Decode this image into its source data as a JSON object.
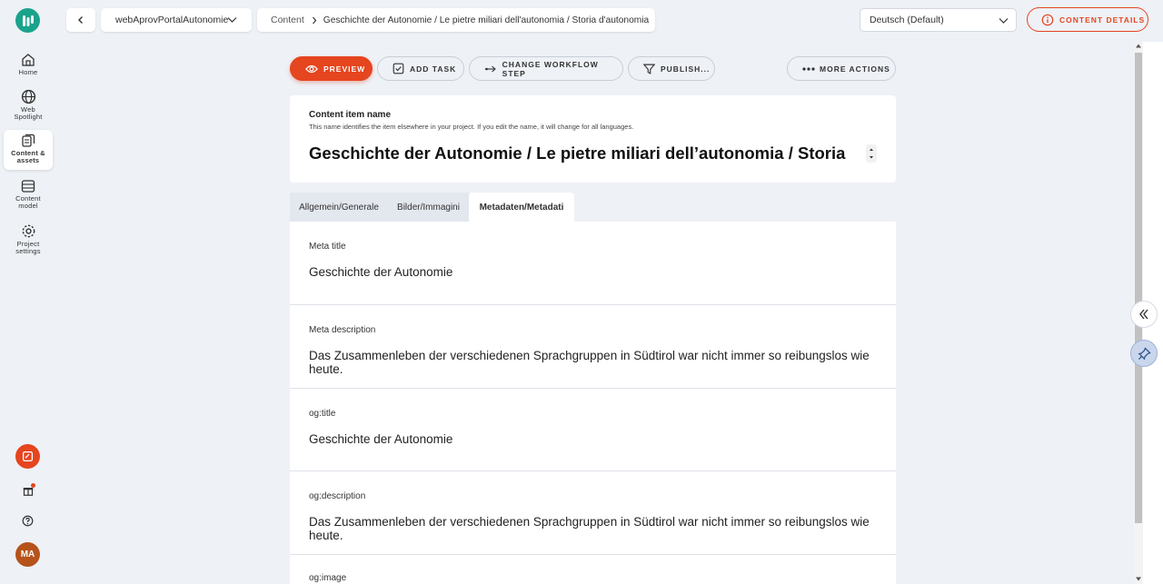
{
  "rail": {
    "items": [
      {
        "label": "Home",
        "icon": "home-icon"
      },
      {
        "label": "Web Spotlight",
        "icon": "globe-icon"
      },
      {
        "label": "Content & assets",
        "icon": "content-icon"
      },
      {
        "label": "Content model",
        "icon": "model-icon"
      },
      {
        "label": "Project settings",
        "icon": "gear-icon"
      }
    ],
    "avatar": "MA"
  },
  "topbar": {
    "project": "webAprovPortalAutonomie",
    "breadcrumb": {
      "root": "Content",
      "item": "Geschichte der Autonomie / Le pietre miliari dell'autonomia / Storia d'autonomia"
    },
    "language": "Deutsch (Default)",
    "details_label": "CONTENT DETAILS"
  },
  "actions": {
    "preview": "PREVIEW",
    "add_task": "ADD TASK",
    "workflow": "CHANGE WORKFLOW STEP",
    "publish": "PUBLISH...",
    "more": "MORE ACTIONS"
  },
  "item_name": {
    "label": "Content item name",
    "hint": "This name identifies the item elsewhere in your project. If you edit the name, it will change for all languages.",
    "value": "Geschichte der Autonomie / Le pietre miliari dell’autonomia / Storia"
  },
  "tabs": [
    "Allgemein/Generale",
    "Bilder/Immagini",
    "Metadaten/Metadati"
  ],
  "fields": [
    {
      "label": "Meta title",
      "value": "Geschichte der Autonomie"
    },
    {
      "label": "Meta description",
      "value": "Das Zusammenleben der verschiedenen Sprachgruppen in Südtirol war nicht immer so reibungslos wie heute."
    },
    {
      "label": "og:title",
      "value": "Geschichte der Autonomie"
    },
    {
      "label": "og:description",
      "value": "Das Zusammenleben der verschiedenen Sprachgruppen in Südtirol war nicht immer so reibungslos wie heute."
    },
    {
      "label": "og:image",
      "value": ""
    }
  ],
  "colors": {
    "accent": "#e5451f",
    "teal": "#1aa38c"
  }
}
